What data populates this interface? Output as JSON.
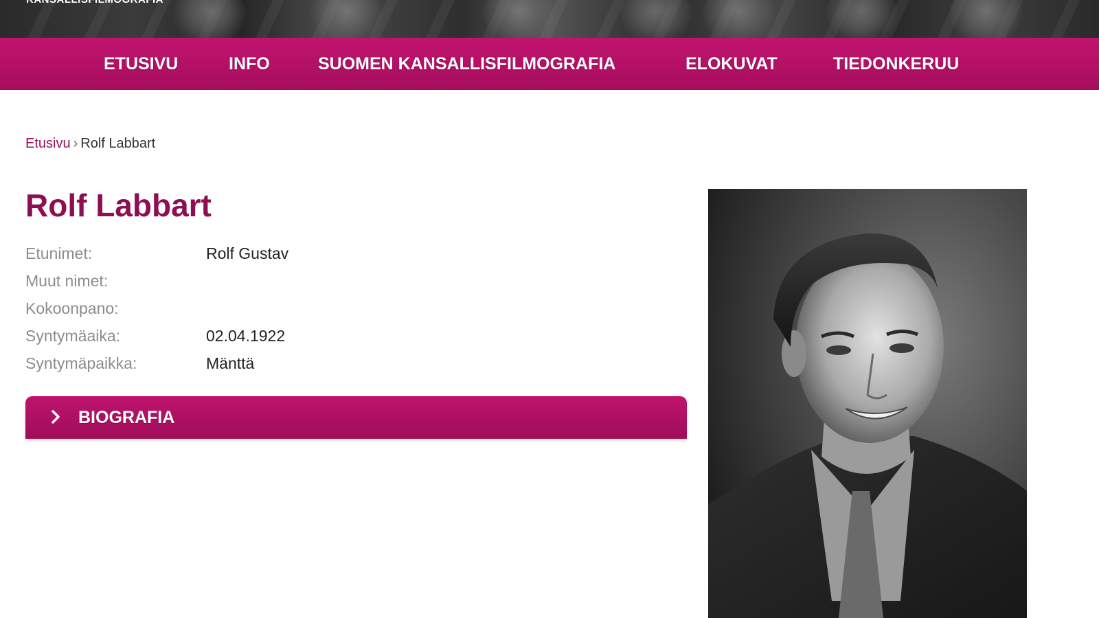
{
  "header": {
    "site_title": "KANSALLISFILMOGRAFIA"
  },
  "nav": {
    "items": [
      {
        "label": "ETUSIVU"
      },
      {
        "label": "INFO"
      },
      {
        "label": "SUOMEN KANSALLISFILMOGRAFIA"
      },
      {
        "label": "ELOKUVAT"
      },
      {
        "label": "TIEDONKERUU"
      }
    ]
  },
  "breadcrumb": {
    "home": "Etusivu",
    "separator": "›",
    "current": "Rolf Labbart"
  },
  "person": {
    "name": "Rolf Labbart",
    "fields": [
      {
        "label": "Etunimet:",
        "value": "Rolf Gustav"
      },
      {
        "label": "Muut nimet:",
        "value": ""
      },
      {
        "label": "Kokoonpano:",
        "value": ""
      },
      {
        "label": "Syntymäaika:",
        "value": "02.04.1922"
      },
      {
        "label": "Syntymäpaikka:",
        "value": "Mänttä"
      }
    ]
  },
  "accordion": {
    "label": "BIOGRAFIA",
    "icon": "chevron-right-icon"
  },
  "colors": {
    "brand": "#b0105f",
    "title": "#8e0e52"
  }
}
